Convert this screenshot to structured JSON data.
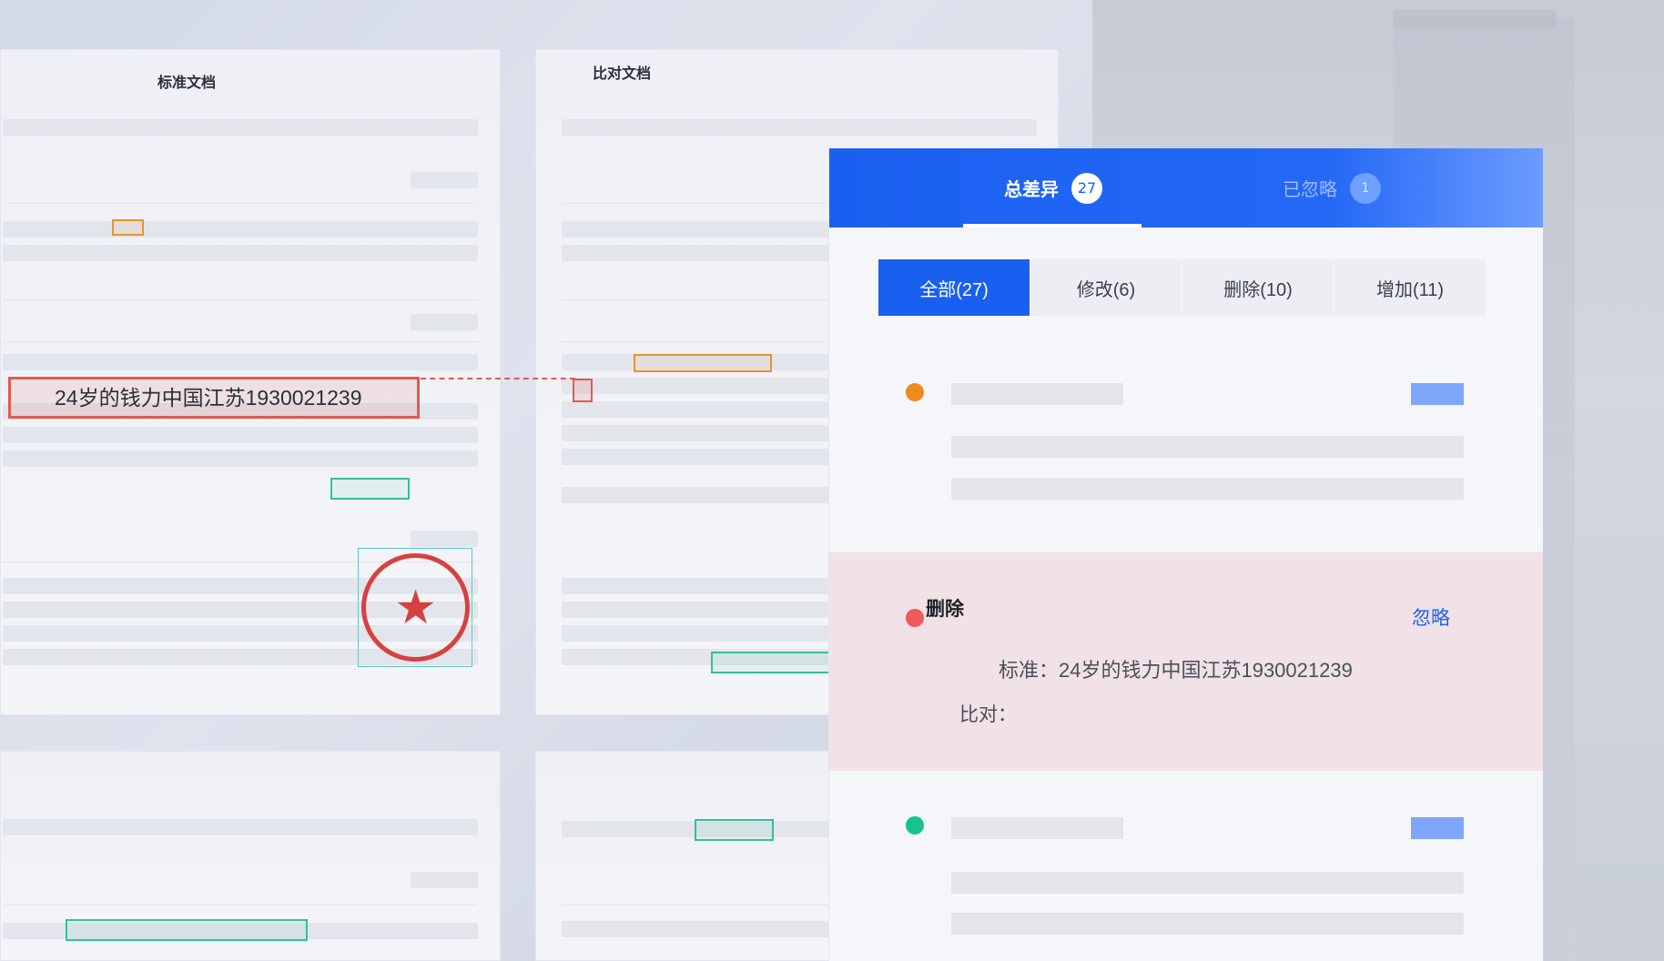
{
  "documents": {
    "standard_title": "标准文档",
    "compare_title": "比对文档",
    "highlighted_text": "24岁的钱力中国江苏1930021239",
    "stamp_icon": "star"
  },
  "diff_panel": {
    "tabs": [
      {
        "label": "总差异",
        "count": "27",
        "active": true
      },
      {
        "label": "已忽略",
        "count": "1",
        "active": false
      }
    ],
    "filters": [
      {
        "label": "全部(27)",
        "active": true
      },
      {
        "label": "修改(6)",
        "active": false
      },
      {
        "label": "删除(10)",
        "active": false
      },
      {
        "label": "增加(11)",
        "active": false
      }
    ],
    "items": [
      {
        "status_color": "#f08a1e"
      },
      {
        "status_color": "#ec5a5a",
        "type": "删除",
        "action": "忽略",
        "standard_line": "标准：24岁的钱力中国江苏1930021239",
        "compare_line": "比对："
      },
      {
        "status_color": "#16c38f"
      }
    ]
  },
  "colors": {
    "accent": "#1a60f0",
    "delete": "#e05a52",
    "modify": "#e9922e",
    "add": "#33c09a"
  }
}
